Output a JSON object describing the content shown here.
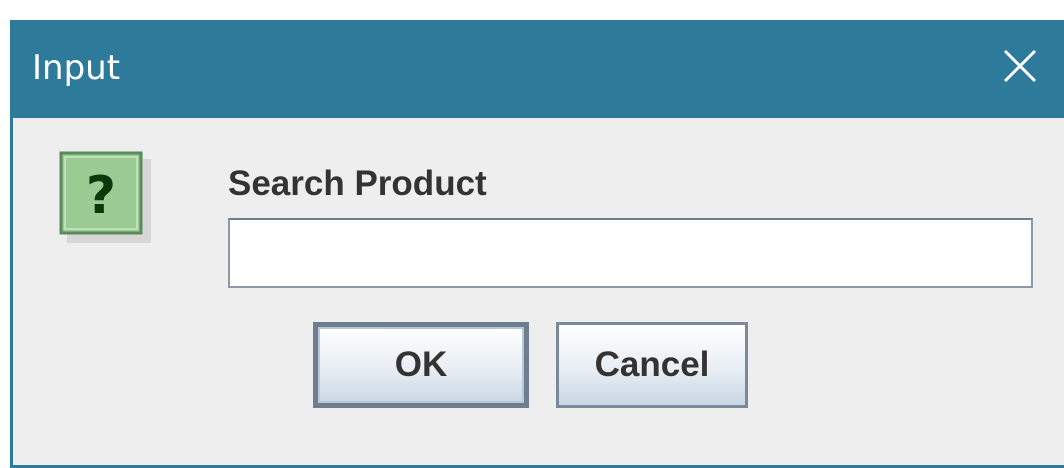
{
  "window": {
    "title": "Input",
    "close_icon": "close-icon",
    "titlebar_color": "#2e7a9b"
  },
  "dialog": {
    "icon": "question-icon",
    "icon_glyph": "?",
    "prompt": "Search Product",
    "input_value": "",
    "ok_label": "OK",
    "cancel_label": "Cancel"
  }
}
